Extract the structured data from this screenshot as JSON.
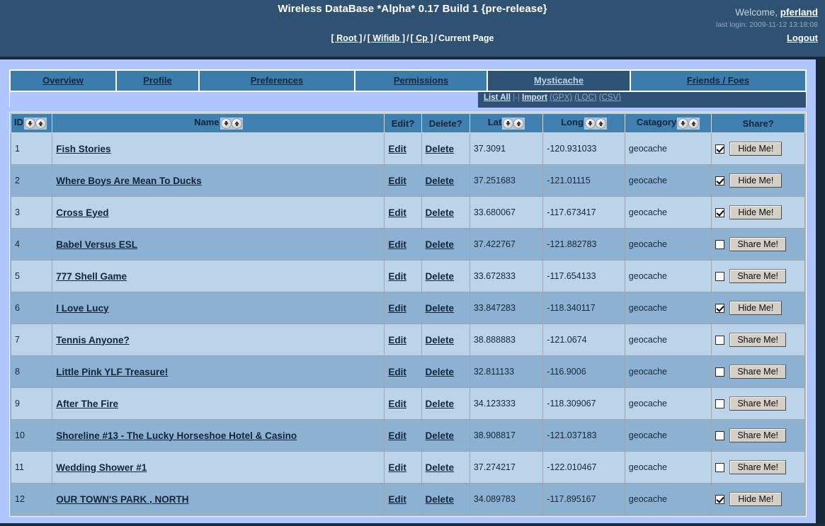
{
  "header": {
    "app_title": "Wireless DataBase *Alpha* 0.17 Build 1 {pre-release}",
    "breadcrumb": {
      "root": "[ Root ]",
      "wifidb": "[ Wifidb ]",
      "cp": "[ Cp ]",
      "current": "Current Page",
      "separator": "/"
    },
    "welcome_prefix": "Welcome,",
    "username": "pferland",
    "last_login": "last login: 2009-11-12 13:18:08",
    "logout": "Logout"
  },
  "tabs": [
    {
      "label": "Overview",
      "active": false
    },
    {
      "label": "Profile",
      "active": false
    },
    {
      "label": "Preferences",
      "active": false
    },
    {
      "label": "Permissions",
      "active": false
    },
    {
      "label": "Mysticache",
      "active": true
    },
    {
      "label": "Friends / Foes",
      "active": false
    }
  ],
  "subnav": {
    "list_all": "List All",
    "divider": "|-|",
    "import": "Import",
    "gpx": "(GPX)",
    "loc": "(LOC)",
    "csv": "(CSV)"
  },
  "table": {
    "columns": [
      {
        "label": "ID",
        "sortable": true
      },
      {
        "label": "Name",
        "sortable": true
      },
      {
        "label": "Edit?",
        "sortable": false
      },
      {
        "label": "Delete?",
        "sortable": false
      },
      {
        "label": "Lat",
        "sortable": true
      },
      {
        "label": "Long",
        "sortable": true
      },
      {
        "label": "Catagory",
        "sortable": true
      },
      {
        "label": "Share?",
        "sortable": false
      }
    ],
    "edit_label": "Edit",
    "delete_label": "Delete",
    "share_button_label": "Share Me!",
    "hide_button_label": "Hide Me!",
    "rows": [
      {
        "id": "1",
        "name": "Fish Stories",
        "lat": "37.3091",
        "long": "-120.931033",
        "category": "geocache",
        "shared": true
      },
      {
        "id": "2",
        "name": "Where Boys Are Mean To Ducks",
        "lat": "37.251683",
        "long": "-121.01115",
        "category": "geocache",
        "shared": true
      },
      {
        "id": "3",
        "name": "Cross Eyed",
        "lat": "33.680067",
        "long": "-117.673417",
        "category": "geocache",
        "shared": true
      },
      {
        "id": "4",
        "name": "Babel Versus ESL",
        "lat": "37.422767",
        "long": "-121.882783",
        "category": "geocache",
        "shared": false
      },
      {
        "id": "5",
        "name": "777 Shell Game",
        "lat": "33.672833",
        "long": "-117.654133",
        "category": "geocache",
        "shared": false
      },
      {
        "id": "6",
        "name": "I Love Lucy",
        "lat": "33.847283",
        "long": "-118.340117",
        "category": "geocache",
        "shared": true
      },
      {
        "id": "7",
        "name": "Tennis Anyone?",
        "lat": "38.888883",
        "long": "-121.0674",
        "category": "geocache",
        "shared": false
      },
      {
        "id": "8",
        "name": "Little Pink YLF Treasure!",
        "lat": "32.811133",
        "long": "-116.9006",
        "category": "geocache",
        "shared": false
      },
      {
        "id": "9",
        "name": "After The Fire",
        "lat": "34.123333",
        "long": "-118.309067",
        "category": "geocache",
        "shared": false
      },
      {
        "id": "10",
        "name": "Shoreline #13 - The Lucky Horseshoe Hotel & Casino",
        "lat": "38.908817",
        "long": "-121.037183",
        "category": "geocache",
        "shared": false
      },
      {
        "id": "11",
        "name": "Wedding Shower #1",
        "lat": "37.274217",
        "long": "-122.010467",
        "category": "geocache",
        "shared": false
      },
      {
        "id": "12",
        "name": "OUR TOWN'S PARK , NORTH",
        "lat": "34.089783",
        "long": "-117.895167",
        "category": "geocache",
        "shared": true
      }
    ]
  },
  "colors": {
    "header_bg": "#2f5272",
    "page_bg": "#aec5fd",
    "tab_bg": "#3c7cac",
    "tab_active_bg": "#2e5275",
    "table_header_bg": "#4080b0",
    "row_odd_bg": "#bcd4ea",
    "row_even_bg": "#8cb1d1",
    "frame_border": "#16273a"
  }
}
